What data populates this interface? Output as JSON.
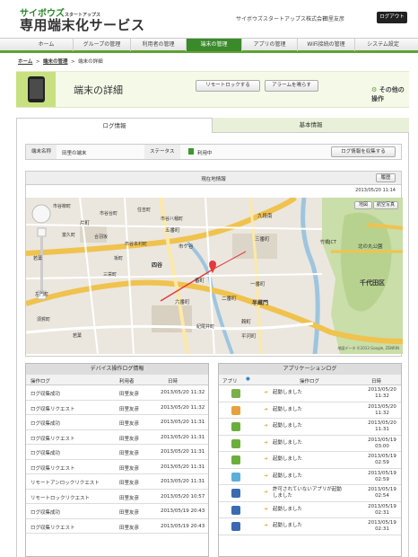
{
  "header": {
    "logo_top": "サイボウズ",
    "logo_small": "スタートアップス",
    "logo_main": "専用端末化サービス",
    "company": "サイボウズスタートアップス株式会社",
    "user": "田里友彦",
    "logout_label": "ログアウト"
  },
  "nav": {
    "items": [
      "ホーム",
      "グループの管理",
      "利用者の管理",
      "端末の管理",
      "アプリの管理",
      "WiFi接続の管理",
      "システム設定"
    ],
    "active": "端末の管理"
  },
  "breadcrumb": [
    "ホーム",
    "端末の管理",
    "端末の詳細"
  ],
  "page": {
    "title": "端末の詳細",
    "remote_lock_label": "リモートロックする",
    "alarm_label": "アラームを鳴らす",
    "other_ops_label": "その他の操作"
  },
  "tabs": [
    "ログ情報",
    "基本情報"
  ],
  "device": {
    "name_label": "端末名称",
    "name_value": "田里の端末",
    "status_label": "ステータス",
    "status_value": "利用中",
    "collect_label": "ログ情報を収集する"
  },
  "location": {
    "title": "現在地情報",
    "history_label": "履歴",
    "timestamp": "2013/05/20 11:14",
    "map_type_buttons": [
      "地図",
      "航空写真"
    ],
    "credit": "地図データ ©2013 Google, ZENRIN",
    "place_labels": [
      "市谷柳町",
      "市谷台町",
      "住吉町",
      "市谷八幡町",
      "九段南",
      "片町",
      "富久町",
      "合羽坂",
      "五番町",
      "市谷本村町",
      "三番町",
      "若葉",
      "坂町",
      "三栄町",
      "市ケ谷",
      "竹橋JCT",
      "千代田区",
      "六番町",
      "番町",
      "一番町",
      "二番町",
      "四谷",
      "半蔵門",
      "麹町",
      "平河町",
      "左門町",
      "須賀町",
      "若葉",
      "北の丸公園",
      "紀尾井町"
    ]
  },
  "device_log": {
    "title": "デバイス操作ログ情報",
    "columns": [
      "操作ログ",
      "利用者",
      "日時"
    ],
    "rows": [
      [
        "ログ収集成功",
        "田里友彦",
        "2013/05/20 11:32"
      ],
      [
        "ログ収集リクエスト",
        "田里友彦",
        "2013/05/20 11:32"
      ],
      [
        "ログ収集成功",
        "田里友彦",
        "2013/05/20 11:31"
      ],
      [
        "ログ収集リクエスト",
        "田里友彦",
        "2013/05/20 11:31"
      ],
      [
        "ログ収集成功",
        "田里友彦",
        "2013/05/20 11:31"
      ],
      [
        "ログ収集リクエスト",
        "田里友彦",
        "2013/05/20 11:31"
      ],
      [
        "リモートアンロックリクエスト",
        "田里友彦",
        "2013/05/20 11:31"
      ],
      [
        "リモートロックリクエスト",
        "田里友彦",
        "2013/05/20 10:57"
      ],
      [
        "ログ収集成功",
        "田里友彦",
        "2013/05/19 20:43"
      ],
      [
        "ログ収集リクエスト",
        "田里友彦",
        "2013/05/19 20:43"
      ]
    ]
  },
  "app_log": {
    "title": "アプリケーションログ",
    "columns": [
      "アプリ",
      "操作ログ",
      "日時"
    ],
    "rows": [
      [
        "起動しました",
        "2013/05/20 11:32"
      ],
      [
        "起動しました",
        "2013/05/20 11:32"
      ],
      [
        "起動しました",
        "2013/05/20 11:31"
      ],
      [
        "起動しました",
        "2013/05/19 03:00"
      ],
      [
        "起動しました",
        "2013/05/19 02:59"
      ],
      [
        "起動しました",
        "2013/05/19 02:59"
      ],
      [
        "許可されていないアプリが起動しました",
        "2013/05/19 02:54"
      ],
      [
        "起動しました",
        "2013/05/19 02:31"
      ],
      [
        "起動しました",
        "2013/05/19 02:31"
      ]
    ]
  }
}
